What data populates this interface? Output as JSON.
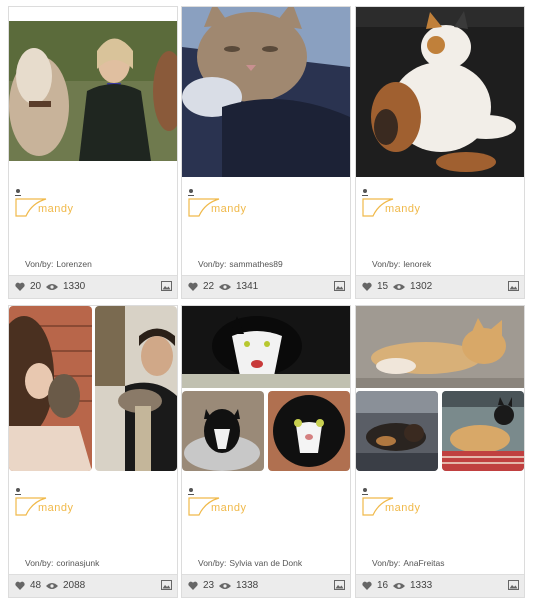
{
  "ui": {
    "by_label": "Von/by:"
  },
  "cards": [
    {
      "tag": "mandy",
      "author": "Lorenzen",
      "likes": "20",
      "views": "1330"
    },
    {
      "tag": "mandy",
      "author": "sammathes89",
      "likes": "22",
      "views": "1341"
    },
    {
      "tag": "mandy",
      "author": "lenorek",
      "likes": "15",
      "views": "1302"
    },
    {
      "tag": "mandy",
      "author": "corinasjunk",
      "likes": "48",
      "views": "2088"
    },
    {
      "tag": "mandy",
      "author": "Sylvia van de Donk",
      "likes": "23",
      "views": "1338"
    },
    {
      "tag": "mandy",
      "author": "AnaFreitas",
      "likes": "16",
      "views": "1333"
    }
  ],
  "icons": {
    "user": "user-icon",
    "tag": "tag-icon",
    "like": "heart-icon",
    "views": "eye-icon",
    "gallery": "image-icon"
  },
  "colors": {
    "tag_accent": "#f0b94a",
    "stats_bar": "#ececec"
  }
}
